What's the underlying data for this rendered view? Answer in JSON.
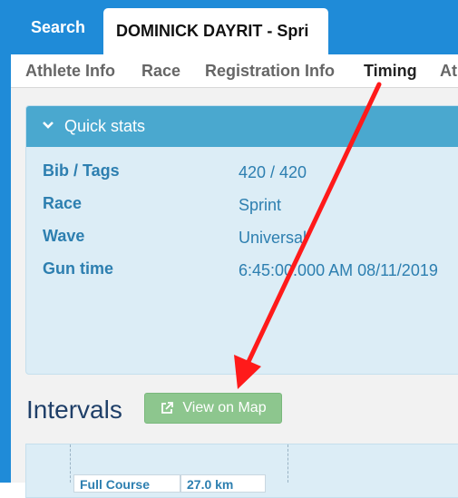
{
  "top_tabs": {
    "search": "Search",
    "athlete": "DOMINICK DAYRIT - Spri"
  },
  "sub_tabs": [
    {
      "label": "Athlete Info"
    },
    {
      "label": "Race"
    },
    {
      "label": "Registration Info"
    },
    {
      "label": "Timing"
    },
    {
      "label": "At"
    }
  ],
  "quick_stats": {
    "title": "Quick stats",
    "rows": [
      {
        "label": "Bib / Tags",
        "value": "420 / 420"
      },
      {
        "label": "Race",
        "value": "Sprint"
      },
      {
        "label": "Wave",
        "value": "Universal"
      },
      {
        "label": "Gun time",
        "value": "6:45:00.000 AM 08/11/2019"
      }
    ]
  },
  "intervals": {
    "title": "Intervals",
    "map_button": "View on Map"
  },
  "table_partial": {
    "cell_1": "Full Course",
    "cell_2": "27.0 km"
  },
  "colors": {
    "topbar": "#1f8bd8",
    "panel_header": "#4aa8cf",
    "map_button": "#8dc68e",
    "annotation_arrow": "#ff0000"
  }
}
